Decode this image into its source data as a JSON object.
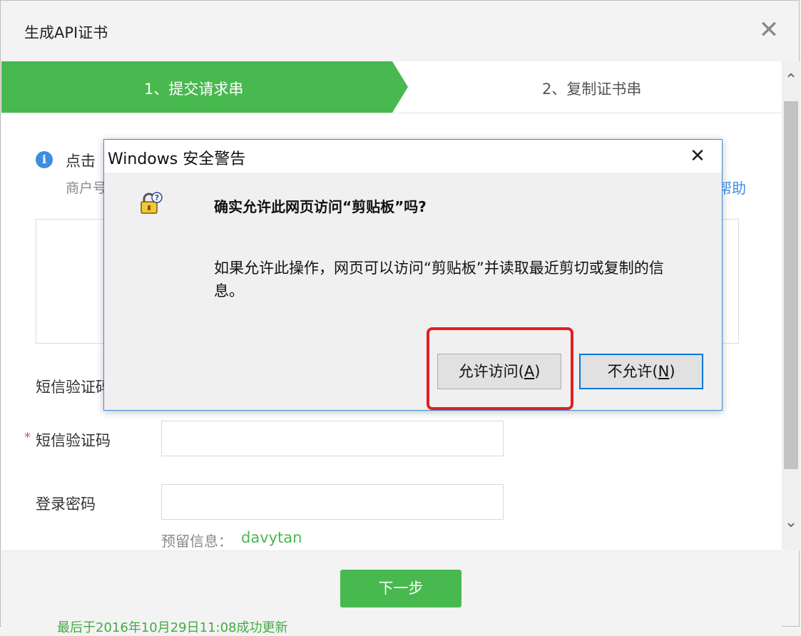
{
  "modal": {
    "title": "生成API证书",
    "close_glyph": "✕"
  },
  "steps": [
    {
      "label": "1、提交请求串",
      "active": true
    },
    {
      "label": "2、复制证书串",
      "active": false
    }
  ],
  "info": {
    "icon_glyph": "i",
    "text": "点击",
    "sub_text": "商户号",
    "help_link": "帮助"
  },
  "form": {
    "sms_code_partial_label": "短信验证码",
    "sms_code_label": "短信验证码",
    "required_mark": "*",
    "password_label": "登录密码",
    "reserve_label": "预留信息：",
    "reserve_value": "davytan"
  },
  "footer": {
    "next_label": "下一步",
    "bottom_peek_text": "最后于2016年10月29日11:08成功更新"
  },
  "scrollbar": {
    "up_glyph": "⌃",
    "down_glyph": "⌄"
  },
  "win_dialog": {
    "title": "Windows 安全警告",
    "close_glyph": "✕",
    "heading": "确实允许此网页访问“剪贴板”吗?",
    "body": "如果允许此操作，网页可以访问“剪贴板”并读取最近剪切或复制的信息。",
    "allow_label_prefix": "允许访问(",
    "allow_label_key": "A",
    "allow_label_suffix": ")",
    "deny_label_prefix": "不允许(",
    "deny_label_key": "N",
    "deny_label_suffix": ")",
    "icon": "security-lock-question-icon"
  },
  "colors": {
    "accent_green": "#48b94e",
    "link_blue": "#3d8ee0",
    "highlight_red": "#e02020",
    "dialog_border": "#3c8ad8"
  }
}
